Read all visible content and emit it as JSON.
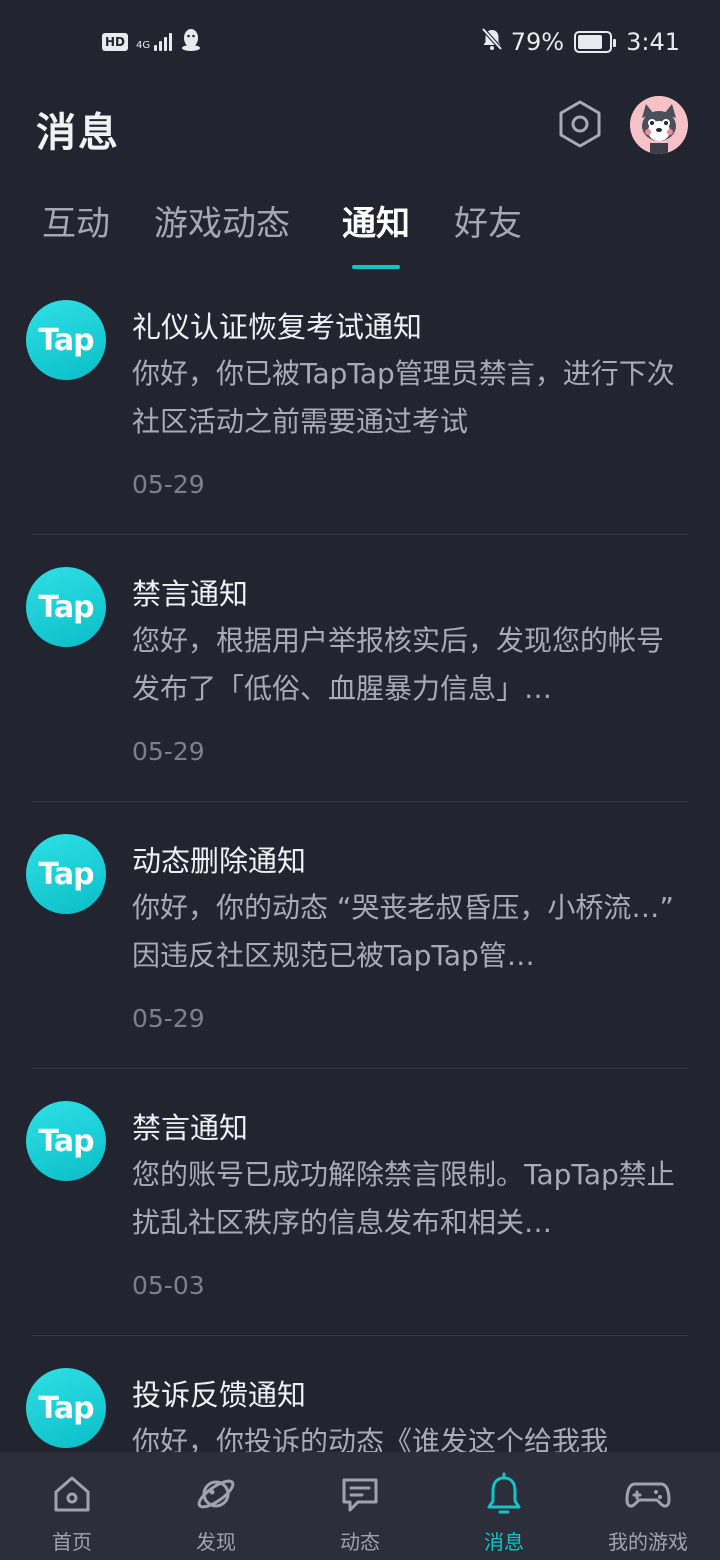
{
  "status_bar": {
    "hd": "HD",
    "network": "4G",
    "battery_percent": "79%",
    "battery_level": 0.79,
    "time": "3:41"
  },
  "header": {
    "title": "消息"
  },
  "tabs": [
    {
      "label": "互动"
    },
    {
      "label": "游戏动态"
    },
    {
      "label": "通知"
    },
    {
      "label": "好友"
    }
  ],
  "active_tab": "通知",
  "notifications": [
    {
      "logo_text": "Tap",
      "title": "礼仪认证恢复考试通知",
      "body": "你好，你已被TapTap管理员禁言，进行下次社区活动之前需要通过考试",
      "date": "05-29"
    },
    {
      "logo_text": "Tap",
      "title": "禁言通知",
      "body": "您好，根据用户举报核实后，发现您的帐号发布了「低俗、血腥暴力信息」…",
      "date": "05-29"
    },
    {
      "logo_text": "Tap",
      "title": "动态删除通知",
      "body": "你好，你的动态 “哭丧老叔昏压，小桥流…” 因违反社区规范已被TapTap管…",
      "date": "05-29"
    },
    {
      "logo_text": "Tap",
      "title": "禁言通知",
      "body": "您的账号已成功解除禁言限制。TapTap禁止扰乱社区秩序的信息发布和相关…",
      "date": "05-03"
    },
    {
      "logo_text": "Tap",
      "title": "投诉反馈通知",
      "body": "你好，你投诉的动态《谁发这个给我我",
      "date": ""
    }
  ],
  "bottom_nav": [
    {
      "label": "首页",
      "icon": "home-icon"
    },
    {
      "label": "发现",
      "icon": "planet-icon"
    },
    {
      "label": "动态",
      "icon": "chat-icon"
    },
    {
      "label": "消息",
      "icon": "bell-icon"
    },
    {
      "label": "我的游戏",
      "icon": "gamepad-icon"
    }
  ],
  "colors": {
    "background": "#222530",
    "accent": "#14c3c8",
    "nav_background": "#2c2f3a"
  }
}
